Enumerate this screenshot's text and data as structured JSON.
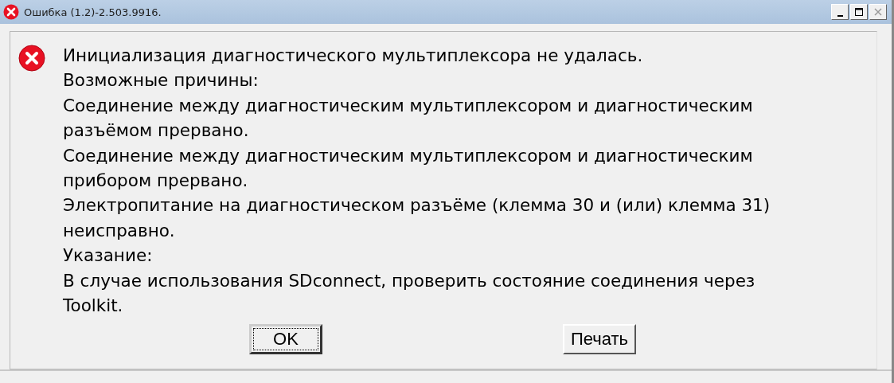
{
  "window": {
    "title": "Ошибка  (1.2)-2.503.9916."
  },
  "message": {
    "lines": [
      "Инициализация диагностического мультиплексора не удалась.",
      "Возможные причины:",
      "Соединение между диагностическим мультиплексором и диагностическим",
      "разъёмом прервано.",
      "Соединение между диагностическим мультиплексором и диагностическим",
      "прибором прервано.",
      "Электропитание на диагностическом разъёме (клемма 30 и (или) клемма 31)",
      "неисправно.",
      "Указание:",
      "В случае использования SDconnect, проверить состояние соединения через",
      "Toolkit."
    ]
  },
  "buttons": [
    {
      "label": "OK",
      "focused": true
    },
    {
      "label": "Печать",
      "focused": false
    }
  ]
}
